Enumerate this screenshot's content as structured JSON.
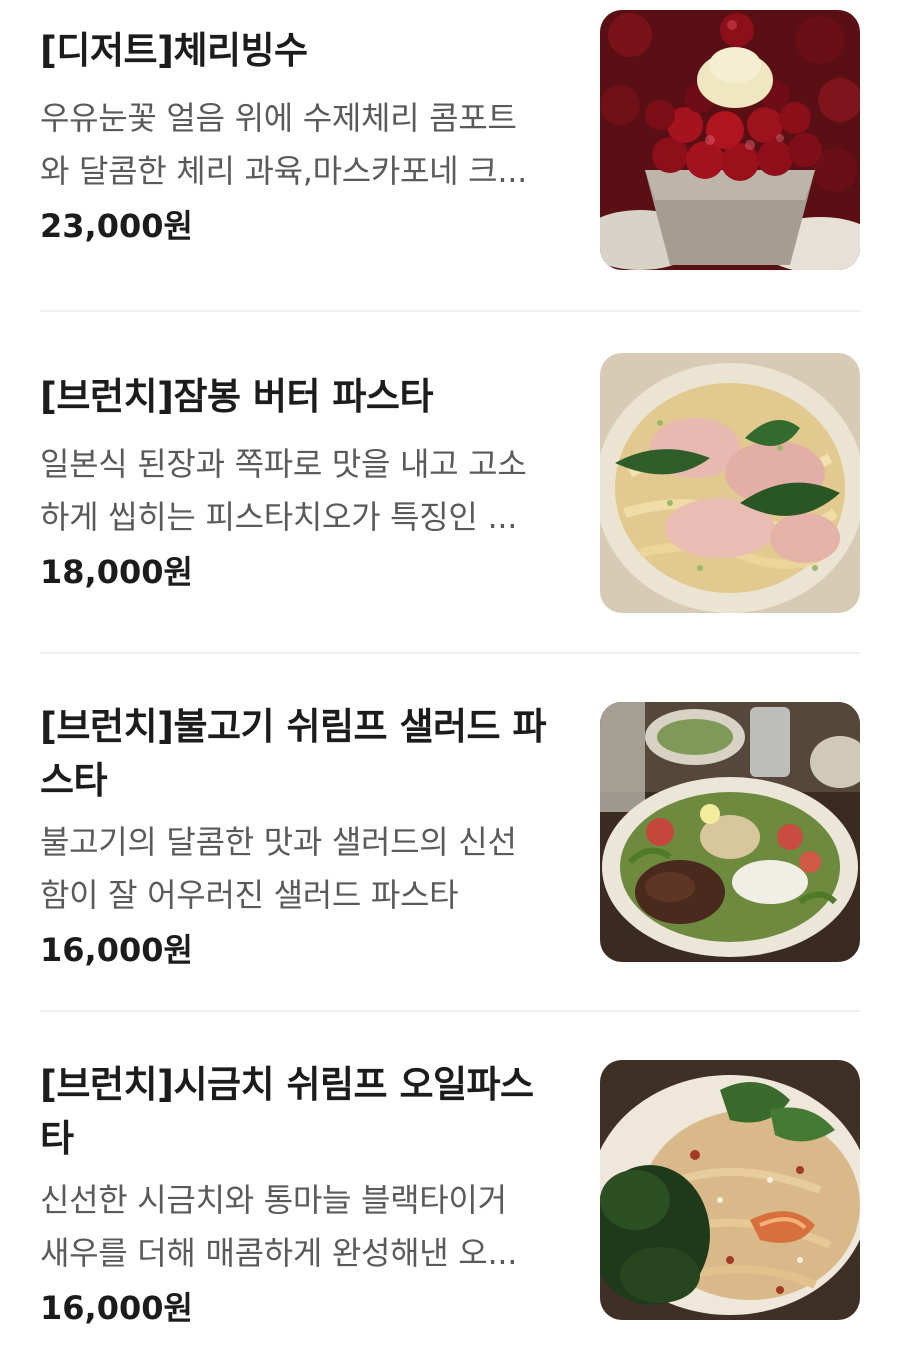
{
  "menu": {
    "items": [
      {
        "name": "[디저트]체리빙수",
        "desc_lines": [
          "우유눈꽃 얼음 위에 수제체리 콤포트",
          "와 달콤한 체리 과육,마스카포네 크..."
        ],
        "price": "23,000원"
      },
      {
        "name": "[브런치]잠봉 버터 파스타",
        "desc_lines": [
          "일본식 된장과 쪽파로 맛을 내고 고소",
          "하게 씹히는 피스타치오가 특징인 ..."
        ],
        "price": "18,000원"
      },
      {
        "name_lines": [
          "[브런치]불고기 쉬림프 샐러드 파",
          "스타"
        ],
        "desc_lines": [
          "불고기의 달콤한 맛과 샐러드의 신선",
          "함이 잘 어우러진 샐러드 파스타"
        ],
        "price": "16,000원"
      },
      {
        "name_lines": [
          "[브런치]시금치 쉬림프 오일파스",
          "타"
        ],
        "desc_lines": [
          "신선한 시금치와 통마늘 블랙타이거",
          "새우를 더해 매콤하게 완성해낸 오..."
        ],
        "price": "16,000원"
      }
    ]
  }
}
